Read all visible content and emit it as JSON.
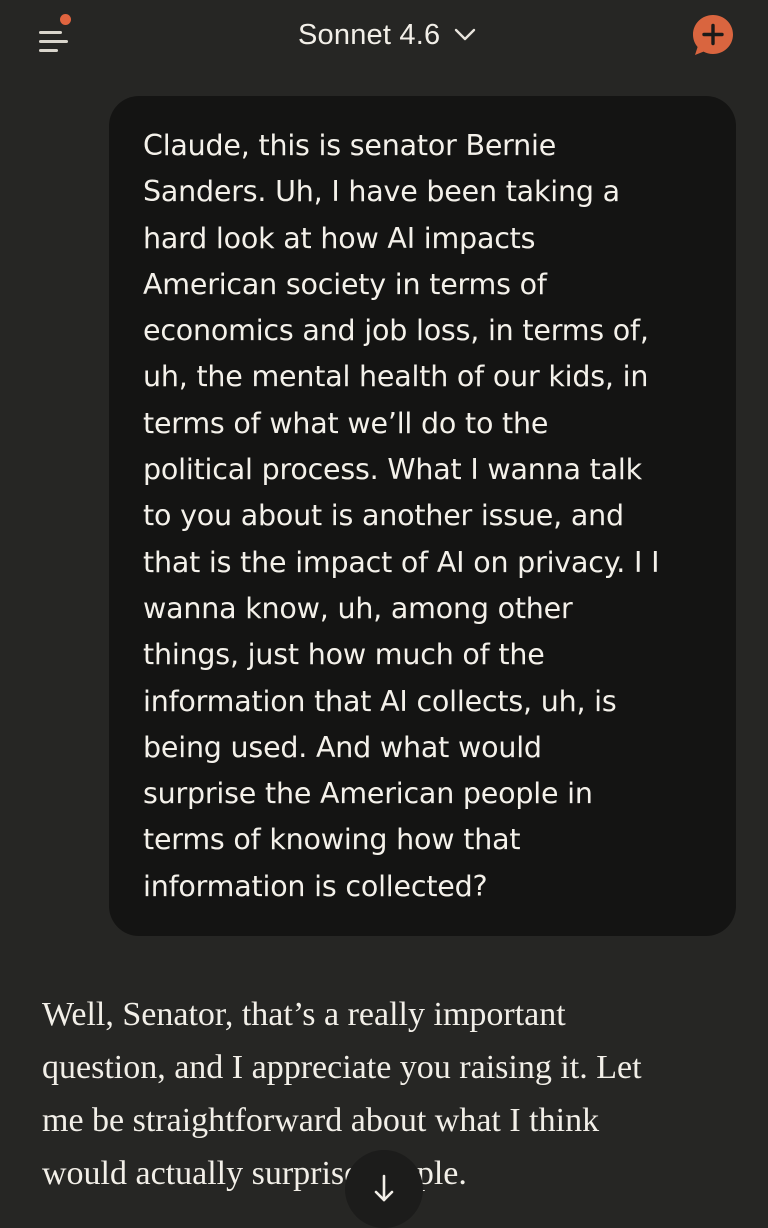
{
  "header": {
    "model_name": "Sonnet 4.6",
    "menu_icon": "menu-lines-icon",
    "notification_color": "#e0643f",
    "model_dropdown_icon": "chevron-down-icon",
    "new_chat_icon": "new-chat-plus-icon",
    "accent_color": "#e0643f"
  },
  "conversation": {
    "user_message": "Claude, this is senator Bernie\nSanders. Uh, I have been taking a\nhard look at how AI impacts\nAmerican society in terms of\neconomics and job loss, in terms of,\nuh, the mental health of our kids, in\nterms of what we’ll do to the\npolitical process. What I wanna talk\nto you about is another issue, and\nthat is the impact of AI on privacy. I I\nwanna know, uh, among other\nthings, just how much of the\ninformation that AI collects, uh, is\nbeing used. And what would\nsurprise the American people in\nterms of knowing how that\ninformation is collected?",
    "assistant_message": "Well, Senator, that’s a really important\nquestion, and I appreciate you raising it. Let\nme be straightforward about what I think\nwould actually surprise people."
  },
  "scroll_button": {
    "icon": "arrow-down-icon"
  }
}
